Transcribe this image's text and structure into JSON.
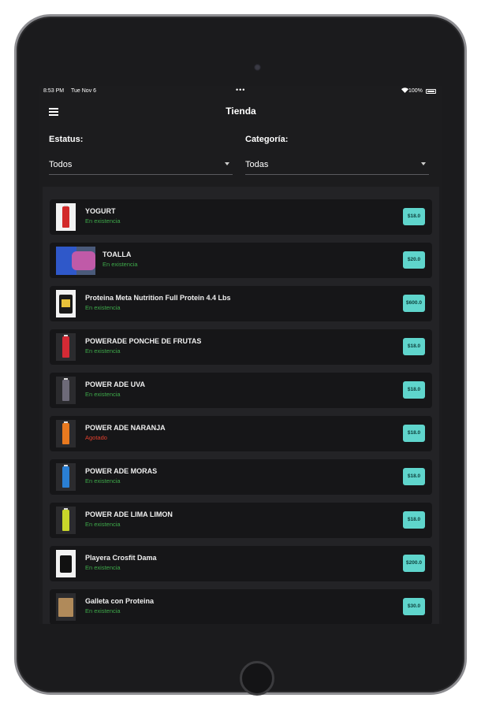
{
  "status_bar": {
    "time": "8:53 PM",
    "date": "Tue Nov 6",
    "dots": "•••",
    "wifi_icon": "wifi-icon",
    "battery_pct": "100%"
  },
  "header": {
    "title": "Tienda",
    "menu_icon": "hamburger-menu-icon"
  },
  "filters": {
    "status": {
      "label": "Estatus:",
      "value": "Todos"
    },
    "category": {
      "label": "Categoría:",
      "value": "Todas"
    }
  },
  "colors": {
    "background": "#1c1c1e",
    "card": "#161618",
    "in_stock": "#3ea94a",
    "out_of_stock": "#e0402e",
    "price_badge": "#5fd5cc"
  },
  "products": [
    {
      "name": "YOGURT",
      "status": "En existencia",
      "price": "$18.0",
      "image": "yogurt-bottle"
    },
    {
      "name": "TOALLA",
      "status": "En existencia",
      "price": "$20.0",
      "image": "towel"
    },
    {
      "name": "Proteina Meta Nutrition Full Protein 4.4 Lbs",
      "status": "En existencia",
      "price": "$600.0",
      "image": "protein-tub"
    },
    {
      "name": "POWERADE PONCHE DE FRUTAS",
      "status": "En existencia",
      "price": "$18.0",
      "image": "red-bottle"
    },
    {
      "name": "POWER ADE UVA",
      "status": "En existencia",
      "price": "$18.0",
      "image": "purple-bottle"
    },
    {
      "name": "POWER ADE NARANJA",
      "status": "Agotado",
      "price": "$18.0",
      "image": "orange-bottle"
    },
    {
      "name": "POWER ADE MORAS",
      "status": "En existencia",
      "price": "$18.0",
      "image": "blue-bottle"
    },
    {
      "name": "POWER ADE LIMA LIMON",
      "status": "En existencia",
      "price": "$18.0",
      "image": "lime-bottle"
    },
    {
      "name": "Playera Crosfit Dama",
      "status": "En existencia",
      "price": "$200.0",
      "image": "tank-top"
    },
    {
      "name": "Galleta con Proteina",
      "status": "En existencia",
      "price": "$30.0",
      "image": "cookie-bag"
    }
  ]
}
